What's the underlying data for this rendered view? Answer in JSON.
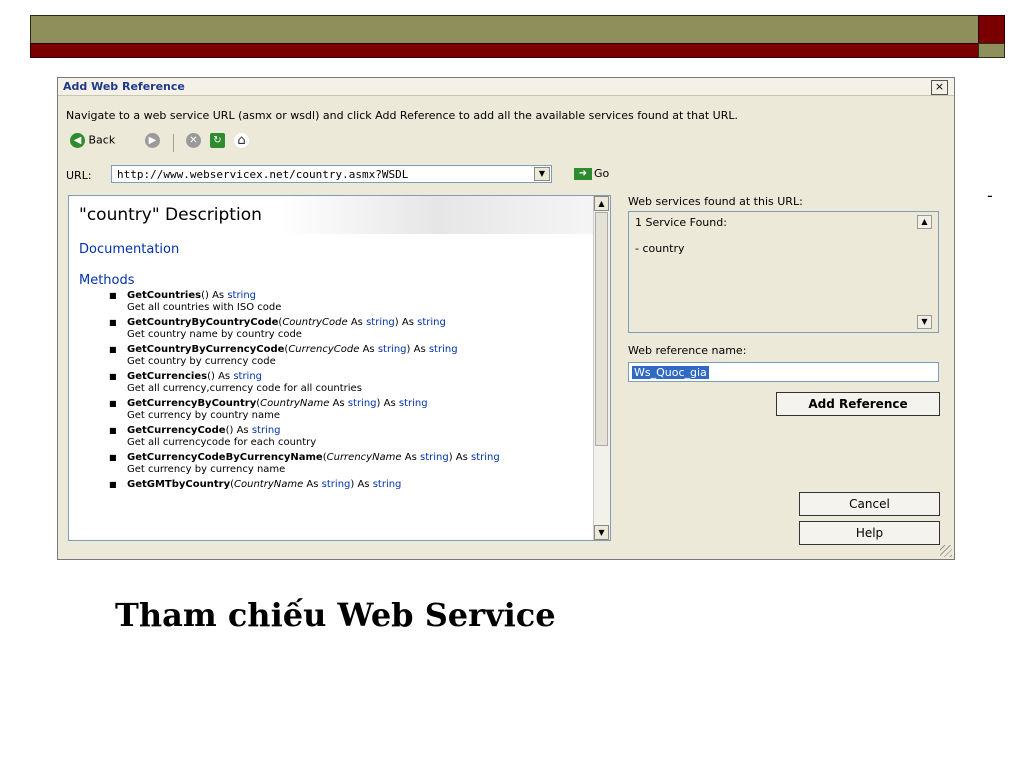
{
  "dialog": {
    "title": "Add Web Reference",
    "close_label": "×",
    "instructions": "Navigate to a web service URL (asmx or wsdl) and click Add Reference to add all the available services found at that URL.",
    "toolbar": {
      "back_label": "Back",
      "icons": [
        "back-arrow-icon",
        "forward-arrow-icon",
        "stop-icon",
        "refresh-icon",
        "home-icon"
      ]
    },
    "url_label": "URL:",
    "url_value": "http://www.webservicex.net/country.asmx?WSDL",
    "go_label": "Go",
    "doc": {
      "title": "\"country\" Description",
      "documentation": "Documentation",
      "methods_heading": "Methods",
      "methods": [
        {
          "name": "GetCountries",
          "sig": "() As ",
          "ret": "string",
          "desc": "Get all countries with ISO code"
        },
        {
          "name": "GetCountryByCountryCode",
          "sig_open": "(",
          "param": "CountryCode",
          "as1": " As ",
          "ptype": "string",
          "sig_close": ") As ",
          "ret": "string",
          "desc": "Get country name by country code"
        },
        {
          "name": "GetCountryByCurrencyCode",
          "sig_open": "(",
          "param": "CurrencyCode",
          "as1": " As ",
          "ptype": "string",
          "sig_close": ") As ",
          "ret": "string",
          "desc": "Get country by currency code"
        },
        {
          "name": "GetCurrencies",
          "sig": "() As ",
          "ret": "string",
          "desc": "Get all currency,currency code for all countries"
        },
        {
          "name": "GetCurrencyByCountry",
          "sig_open": "(",
          "param": "CountryName",
          "as1": " As ",
          "ptype": "string",
          "sig_close": ") As ",
          "ret": "string",
          "desc": "Get currency by country name"
        },
        {
          "name": "GetCurrencyCode",
          "sig": "() As ",
          "ret": "string",
          "desc": "Get all currencycode for each country"
        },
        {
          "name": "GetCurrencyCodeByCurrencyName",
          "sig_open": "(",
          "param": "CurrencyName",
          "as1": " As ",
          "ptype": "string",
          "sig_close": ") As ",
          "ret": "string",
          "desc": "Get currency by currency name"
        },
        {
          "name": "GetGMTbyCountry",
          "sig_open": "(",
          "param": "CountryName",
          "as1": " As ",
          "ptype": "string",
          "sig_close": ") As ",
          "ret": "string",
          "desc": ""
        }
      ]
    },
    "services": {
      "label": "Web services found at this URL:",
      "found": "1 Service Found:",
      "items": [
        "- country"
      ]
    },
    "reference": {
      "label": "Web reference name:",
      "value": "Ws_Quoc_gia"
    },
    "buttons": {
      "add": "Add Reference",
      "cancel": "Cancel",
      "help": "Help"
    }
  },
  "slide": {
    "caption": "Tham chiếu Web Service",
    "dash": "-"
  },
  "colors": {
    "bar_olive": "#8f8f5c",
    "bar_red": "#7a0000",
    "link_blue": "#0033aa",
    "selection": "#316ac5"
  }
}
